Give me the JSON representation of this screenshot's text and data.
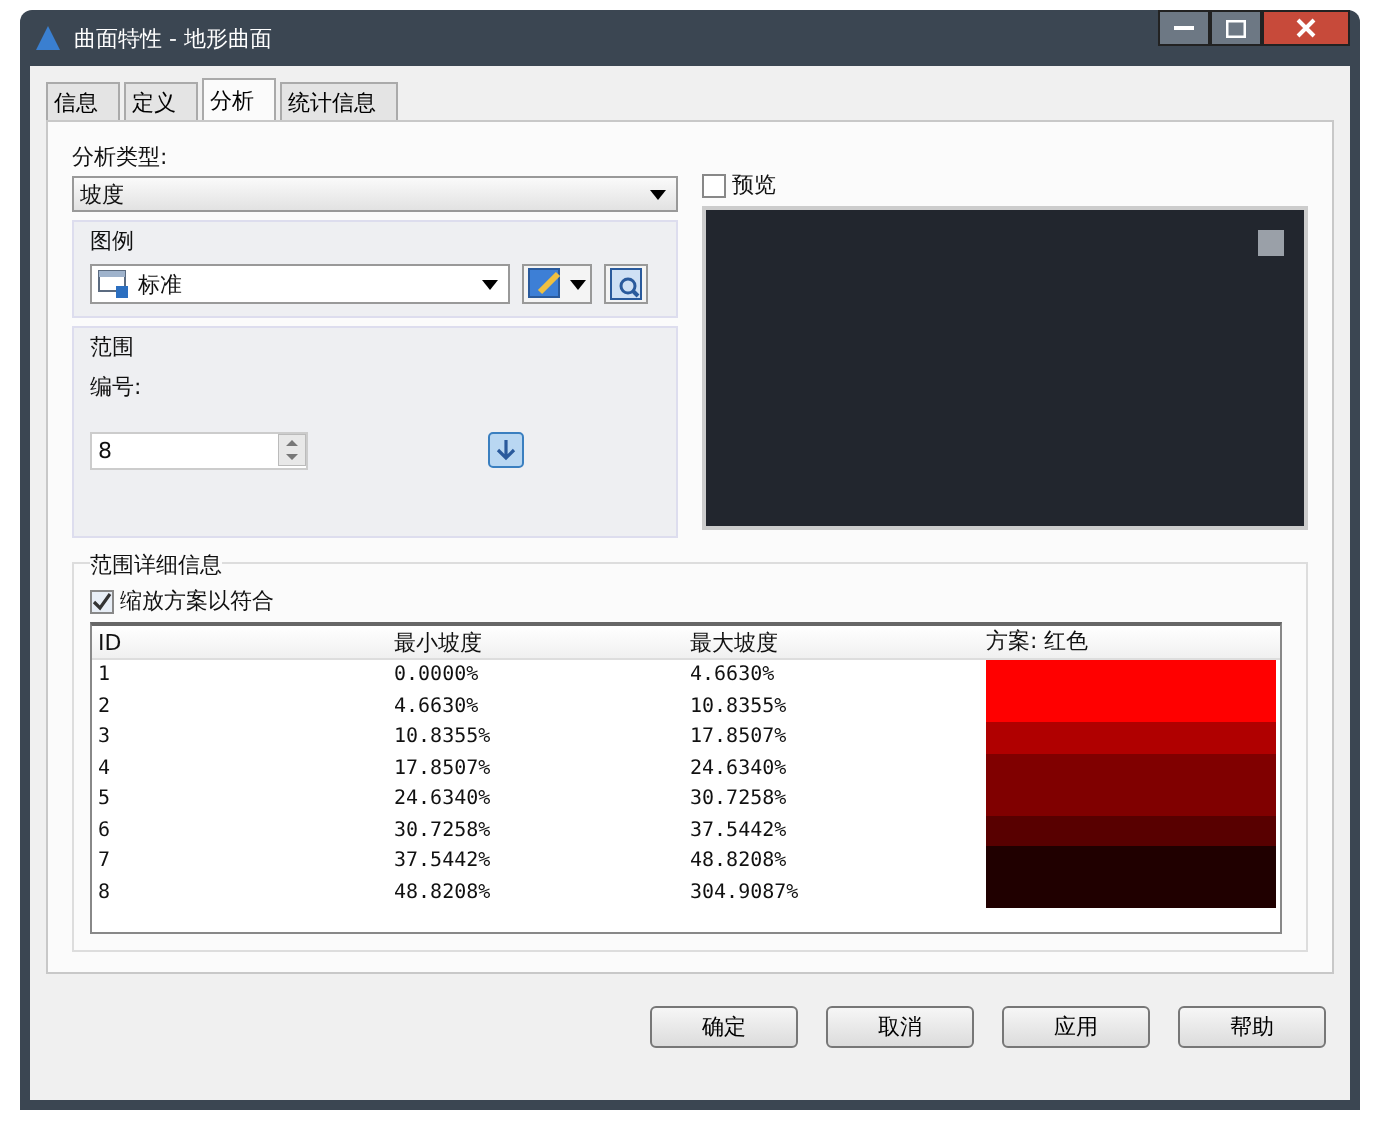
{
  "window": {
    "title": "曲面特性 - 地形曲面"
  },
  "tabs": [
    {
      "label": "信息",
      "selected": false
    },
    {
      "label": "定义",
      "selected": false
    },
    {
      "label": "分析",
      "selected": true
    },
    {
      "label": "统计信息",
      "selected": false
    }
  ],
  "analysis_type": {
    "label": "分析类型:",
    "value": "坡度"
  },
  "legend": {
    "title": "图例",
    "value": "标准"
  },
  "range": {
    "title": "范围",
    "number_label": "编号:",
    "number": "8"
  },
  "preview": {
    "label": "预览",
    "checked": false
  },
  "range_details": {
    "title": "范围详细信息",
    "fit_scheme": {
      "label": "缩放方案以符合",
      "checked": true
    },
    "columns": [
      "ID",
      "最小坡度",
      "最大坡度",
      "方案: 红色"
    ],
    "rows": [
      {
        "id": "1",
        "min": "0.0000%",
        "max": "4.6630%",
        "color": "#ff0000"
      },
      {
        "id": "2",
        "min": "4.6630%",
        "max": "10.8355%",
        "color": "#ff0000"
      },
      {
        "id": "3",
        "min": "10.8355%",
        "max": "17.8507%",
        "color": "#b00000"
      },
      {
        "id": "4",
        "min": "17.8507%",
        "max": "24.6340%",
        "color": "#800000"
      },
      {
        "id": "5",
        "min": "24.6340%",
        "max": "30.7258%",
        "color": "#800000"
      },
      {
        "id": "6",
        "min": "30.7258%",
        "max": "37.5442%",
        "color": "#580000"
      },
      {
        "id": "7",
        "min": "37.5442%",
        "max": "48.8208%",
        "color": "#200000"
      },
      {
        "id": "8",
        "min": "48.8208%",
        "max": "304.9087%",
        "color": "#200000"
      }
    ]
  },
  "buttons": [
    "确定",
    "取消",
    "应用",
    "帮助"
  ]
}
